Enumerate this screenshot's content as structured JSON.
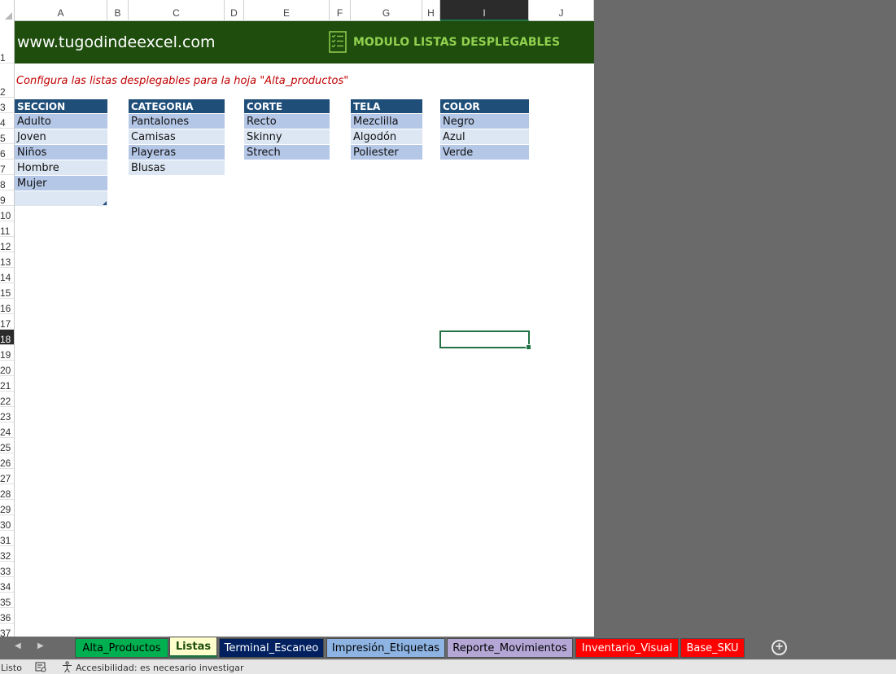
{
  "columns": [
    "A",
    "B",
    "C",
    "D",
    "E",
    "F",
    "G",
    "H",
    "I",
    "J"
  ],
  "active_column": "I",
  "rows": [
    "1",
    "2",
    "3",
    "4",
    "5",
    "6",
    "7",
    "8",
    "9",
    "10",
    "11",
    "12",
    "13",
    "14",
    "15",
    "16",
    "17",
    "18",
    "19",
    "20",
    "21",
    "22",
    "23",
    "24",
    "25",
    "26",
    "27",
    "28",
    "29",
    "30",
    "31",
    "32",
    "33",
    "34",
    "35",
    "36",
    "37"
  ],
  "active_row": "18",
  "header": {
    "site": "www.tugodindeexcel.com",
    "module_title": "MODULO LISTAS DESPLEGABLES"
  },
  "subtitle": "Configura las listas desplegables para la hoja \"Alta_productos\"",
  "lists": [
    {
      "header": "SECCION",
      "items": [
        "Adulto",
        "Joven",
        "Niños",
        "Hombre",
        "Mujer",
        ""
      ]
    },
    {
      "header": "CATEGORIA",
      "items": [
        "Pantalones",
        "Camisas",
        "Playeras",
        "Blusas"
      ]
    },
    {
      "header": "CORTE",
      "items": [
        "Recto",
        "Skinny",
        "Strech"
      ]
    },
    {
      "header": "TELA",
      "items": [
        "Mezclilla",
        "Algodón",
        "Poliester"
      ]
    },
    {
      "header": "COLOR",
      "items": [
        "Negro",
        "Azul",
        "Verde"
      ]
    }
  ],
  "sheet_tabs": [
    {
      "label": "Alta_Productos",
      "bg": "#00b050",
      "fg": "#000000"
    },
    {
      "label": "Listas",
      "bg": "#ffffcc",
      "fg": "#1e4d0d",
      "active": true
    },
    {
      "label": "Terminal_Escaneo",
      "bg": "#002060",
      "fg": "#ffffff"
    },
    {
      "label": "Impresión_Etiquetas",
      "bg": "#8eb4e3",
      "fg": "#000000"
    },
    {
      "label": "Reporte_Movimientos",
      "bg": "#b4a7d6",
      "fg": "#000000"
    },
    {
      "label": "Inventario_Visual",
      "bg": "#ff0000",
      "fg": "#ffffff"
    },
    {
      "label": "Base_SKU",
      "bg": "#ff0000",
      "fg": "#ffffff"
    }
  ],
  "add_sheet_icon": "plus-circle-icon",
  "statusbar": {
    "ready": "Listo",
    "accessibility": "Accesibilidad: es necesario investigar"
  },
  "colors": {
    "title_band": "#1e4d0d",
    "module_title": "#92d050",
    "subtitle": "#c00000",
    "list_header": "#1f4e79",
    "list_odd": "#b4c7e7",
    "list_even": "#dde7f3",
    "selection": "#217346"
  }
}
